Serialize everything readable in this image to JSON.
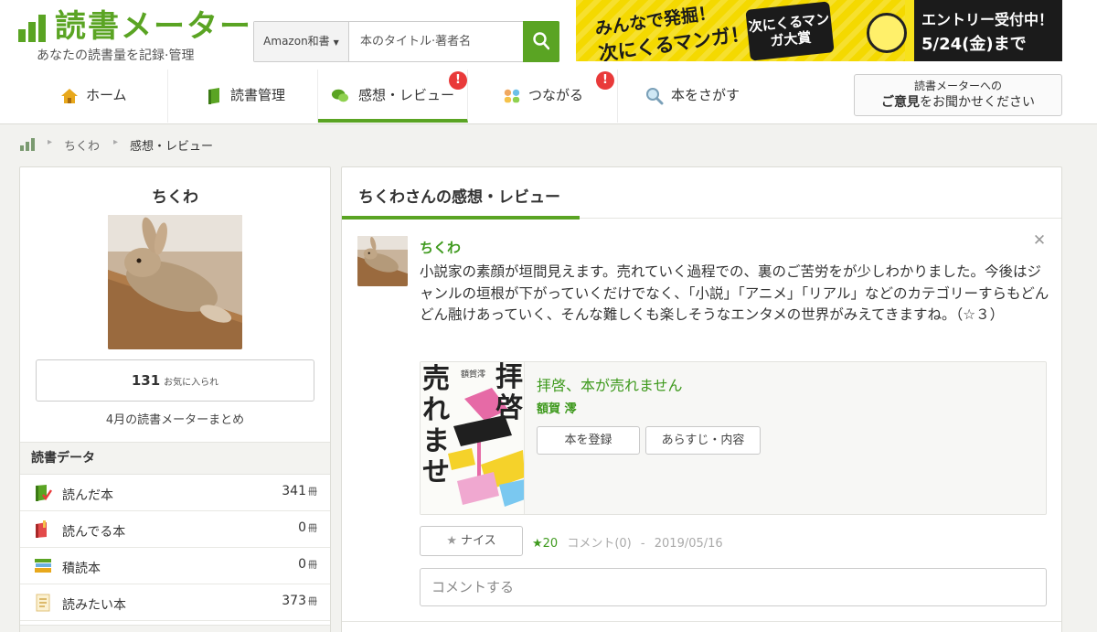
{
  "header": {
    "logo_title": "読書メーター",
    "logo_subtitle": "あなたの読書量を記録·管理",
    "search": {
      "category": "Amazon和書",
      "placeholder": "本のタイトル·著者名"
    },
    "banner": {
      "line1": "みんなで発掘！",
      "line2": "次にくるマンガ！",
      "badge": "次にくるマンガ大賞",
      "right1": "エントリー受付中！",
      "right2": "5/24(金)まで"
    },
    "nav": [
      {
        "label": "ホーム",
        "icon": "home-icon"
      },
      {
        "label": "読書管理",
        "icon": "book-icon"
      },
      {
        "label": "感想・レビュー",
        "icon": "speech-bubble-icon",
        "alert": "!"
      },
      {
        "label": "つながる",
        "icon": "people-icon",
        "alert": "!"
      },
      {
        "label": "本をさがす",
        "icon": "magnifier-icon"
      }
    ],
    "feedback": {
      "line1": "読書メーターへの",
      "line2_bold": "ご意見",
      "line2_rest": "をお聞かせください"
    }
  },
  "breadcrumb": {
    "items": [
      "ちくわ",
      "感想・レビュー"
    ]
  },
  "sidebar": {
    "name": "ちくわ",
    "favorites_count": "131",
    "favorites_label": "お気に入られ",
    "monthly_link": "4月の読書メーターまとめ",
    "section_title": "読書データ",
    "stats": [
      {
        "label": "読んだ本",
        "value": "341",
        "unit": "冊",
        "icon": "read-book-icon"
      },
      {
        "label": "読んでる本",
        "value": "0",
        "unit": "冊",
        "icon": "reading-book-icon"
      },
      {
        "label": "積読本",
        "value": "0",
        "unit": "冊",
        "icon": "stacked-books-icon"
      },
      {
        "label": "読みたい本",
        "value": "373",
        "unit": "冊",
        "icon": "wishlist-icon"
      }
    ]
  },
  "main": {
    "title": "ちくわさんの感想・レビュー",
    "review": {
      "user": "ちくわ",
      "text": "小説家の素顔が垣間見えます。売れていく過程での、裏のご苦労をが少しわかりました。今後はジャンルの垣根が下がっていくだけでなく、「小説」「アニメ」「リアル」などのカテゴリーすらもどんどん融けあっていく、そんな難しくも楽しそうなエンタメの世界がみえてきますね。（☆３）",
      "book_title": "拝啓、本が売れません",
      "book_author": "額賀 澪",
      "register_label": "本を登録",
      "summary_label": "あらすじ・内容",
      "nice_label": "ナイス",
      "nice_count": "★20",
      "comments": "コメント(0)",
      "date": "2019/05/16",
      "comment_placeholder": "コメントする"
    },
    "cover": {
      "col1": "売れませ",
      "col2": "拝啓",
      "author_small": "額賀澪"
    }
  },
  "colors": {
    "brand_green": "#5aa423",
    "link_green": "#3f9a1e",
    "alert_red": "#e93a3a"
  }
}
